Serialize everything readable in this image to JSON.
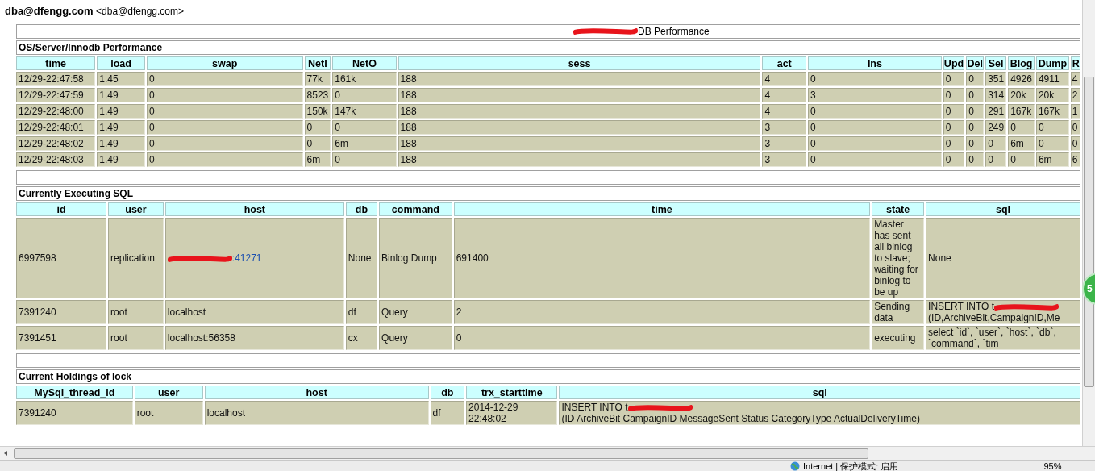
{
  "header": {
    "sender_name": "dba@dfengg.com",
    "sender_address": "<dba@dfengg.com>"
  },
  "report_heading": [
    {
      "kind": "redaction"
    },
    {
      "kind": "text",
      "text": "DB Performance"
    }
  ],
  "sections": [
    {
      "title": "OS/Server/Innodb Performance",
      "columns": [
        "time",
        "load",
        "swap",
        "NetI",
        "NetO",
        "sess",
        "act",
        "Ins",
        "Upd",
        "Del",
        "Sel",
        "Blog",
        "Dump",
        "R"
      ],
      "rows": [
        [
          "12/29-22:47:58",
          "1.45",
          "0",
          "77k",
          "161k",
          "188",
          "4",
          "0",
          "0",
          "0",
          "351",
          "4926",
          "4911",
          "4"
        ],
        [
          "12/29-22:47:59",
          "1.49",
          "0",
          "8523",
          "0",
          "188",
          "4",
          "3",
          "0",
          "0",
          "314",
          "20k",
          "20k",
          "2"
        ],
        [
          "12/29-22:48:00",
          "1.49",
          "0",
          "150k",
          "147k",
          "188",
          "4",
          "0",
          "0",
          "0",
          "291",
          "167k",
          "167k",
          "1"
        ],
        [
          "12/29-22:48:01",
          "1.49",
          "0",
          "0",
          "0",
          "188",
          "3",
          "0",
          "0",
          "0",
          "249",
          "0",
          "0",
          "0"
        ],
        [
          "12/29-22:48:02",
          "1.49",
          "0",
          "0",
          "6m",
          "188",
          "3",
          "0",
          "0",
          "0",
          "0",
          "6m",
          "0",
          "0"
        ],
        [
          "12/29-22:48:03",
          "1.49",
          "0",
          "6m",
          "0",
          "188",
          "3",
          "0",
          "0",
          "0",
          "0",
          "0",
          "6m",
          "6"
        ]
      ]
    },
    {
      "title": "Currently Executing SQL",
      "columns": [
        "id",
        "user",
        "host",
        "db",
        "command",
        "time",
        "state",
        "sql"
      ],
      "rows": [
        [
          "6997598",
          "replication",
          [
            {
              "kind": "redaction"
            },
            {
              "kind": "link",
              "text": ":41271"
            }
          ],
          "None",
          "Binlog Dump",
          "691400",
          "Master has sent all binlog to slave; waiting for binlog to be up",
          "None"
        ],
        [
          "7391240",
          "root",
          "localhost",
          "df",
          "Query",
          "2",
          "Sending data",
          [
            {
              "kind": "text",
              "text": "INSERT INTO t"
            },
            {
              "kind": "redaction"
            },
            {
              "kind": "text",
              "text": "(ID,ArchiveBit,CampaignID,Me"
            }
          ]
        ],
        [
          "7391451",
          "root",
          "localhost:56358",
          "cx",
          "Query",
          "0",
          "executing",
          "select `id`, `user`, `host`, `db`, `command`, `tim"
        ]
      ]
    },
    {
      "title": "Current Holdings of lock",
      "columns": [
        "MySql_thread_id",
        "user",
        "host",
        "db",
        "trx_starttime",
        "sql"
      ],
      "rows": [
        [
          "7391240",
          "root",
          "localhost",
          "df",
          "2014-12-29 22:48:02",
          [
            {
              "kind": "text",
              "text": "INSERT INTO t"
            },
            {
              "kind": "redaction"
            },
            {
              "kind": "text",
              "text": "(ID ArchiveBit CampaignID MessageSent Status CategoryType ActualDeliveryTime)"
            }
          ]
        ]
      ]
    }
  ],
  "floating_badge": "5",
  "status_bar": {
    "zone": "Internet | 保护模式: 启用",
    "zoom": "95%"
  }
}
